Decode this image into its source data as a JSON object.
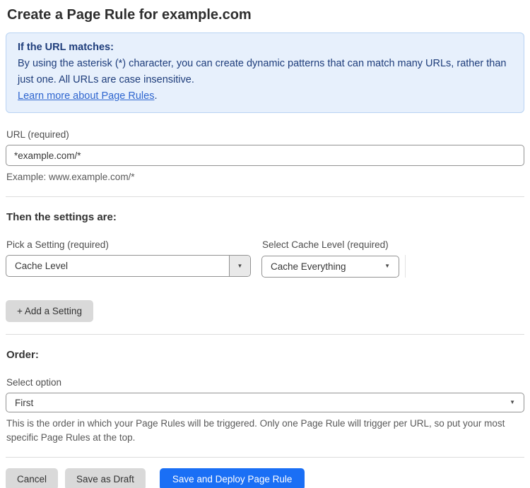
{
  "page": {
    "title": "Create a Page Rule for example.com"
  },
  "info_box": {
    "heading": "If the URL matches:",
    "body": "By using the asterisk (*) character, you can create dynamic patterns that can match many URLs, rather than just one. All URLs are case insensitive.",
    "link_label": "Learn more about Page Rules",
    "link_suffix": "."
  },
  "url_field": {
    "label": "URL (required)",
    "value": "*example.com/*",
    "helper": "Example: www.example.com/*"
  },
  "settings_section": {
    "heading": "Then the settings are:",
    "setting_picker": {
      "label": "Pick a Setting (required)",
      "value": "Cache Level"
    },
    "cache_level_picker": {
      "label": "Select Cache Level (required)",
      "value": "Cache Everything"
    },
    "add_setting_label": "+ Add a Setting"
  },
  "order_section": {
    "heading": "Order:",
    "label": "Select option",
    "value": "First",
    "helper": "This is the order in which your Page Rules will be triggered. Only one Page Rule will trigger per URL, so put your most specific Page Rules at the top."
  },
  "footer": {
    "cancel_label": "Cancel",
    "save_draft_label": "Save as Draft",
    "save_deploy_label": "Save and Deploy Page Rule"
  },
  "icons": {
    "dropdown_arrow": "▼"
  },
  "colors": {
    "info_box_bg": "#e7f0fc",
    "info_box_border": "#b9d3f3",
    "info_box_text": "#1e3d7b",
    "link": "#2e65cf",
    "primary_button": "#1a6ff5",
    "secondary_button": "#d9d9d9",
    "input_border": "#929292",
    "divider": "#dcdcdc"
  }
}
